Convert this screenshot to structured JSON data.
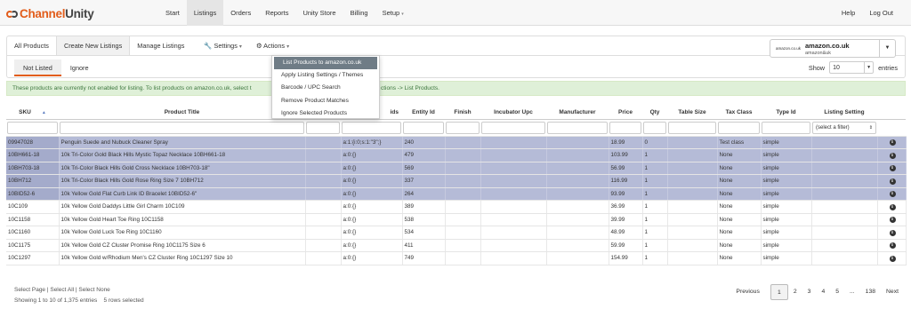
{
  "brand": {
    "part1": "Channel",
    "part2": "Unity"
  },
  "nav": {
    "items": [
      "Start",
      "Listings",
      "Orders",
      "Reports",
      "Unity Store",
      "Billing",
      "Setup"
    ],
    "right": [
      "Help",
      "Log Out"
    ]
  },
  "tabs": {
    "all": "All Products",
    "create": "Create New Listings",
    "manage": "Manage Listings",
    "settings": "Settings",
    "actions": "Actions"
  },
  "subtabs": {
    "not_listed": "Not Listed",
    "ignore": "Ignore"
  },
  "account": {
    "logo_text": "amazon.co.uk",
    "name": "amazon.co.uk",
    "sub": "amazon&uk"
  },
  "show": {
    "label": "Show",
    "value": "10",
    "suffix": "entries"
  },
  "notice": {
    "left": "These products are currently not enabled for listing. To list products on amazon.co.uk, select t",
    "right": "ctions -> List Products."
  },
  "dropdown": [
    "List Products to amazon.co.uk",
    "Apply Listing Settings / Themes",
    "Barcode / UPC Search",
    "Remove Product Matches",
    "Ignore Selected Products"
  ],
  "columns": [
    "SKU",
    "Product Title",
    "ids",
    "Entity Id",
    "Finish",
    "Incubator Upc",
    "Manufacturer",
    "Price",
    "Qty",
    "Table Size",
    "Tax Class",
    "Type Id",
    "Listing Setting"
  ],
  "filter_select": "(select a filter)",
  "rows": [
    {
      "sku": "09947028",
      "title": "Penguin Suede and Nubuck Cleaner Spray",
      "ids": "a:1:{i:0;s:1:\"3\";}",
      "entity": "240",
      "price": "18.99",
      "qty": "0",
      "tax": "Test class",
      "type": "simple",
      "selected": true
    },
    {
      "sku": "10BH661-18",
      "title": "10k Tri-Color Gold Black Hills Mystic Topaz Necklace 10BH661-18",
      "ids": "a:0:{}",
      "entity": "479",
      "price": "103.99",
      "qty": "1",
      "tax": "None",
      "type": "simple",
      "selected": true
    },
    {
      "sku": "10BH703-18",
      "title": "10k Tri-Color Black Hills Gold Cross Necklace 10BH703-18\"",
      "ids": "a:0:{}",
      "entity": "569",
      "price": "56.99",
      "qty": "1",
      "tax": "None",
      "type": "simple",
      "selected": true
    },
    {
      "sku": "10BH712",
      "title": "10k Tri-Color Black Hills Gold Rose Ring Size 7 10BH712",
      "ids": "a:0:{}",
      "entity": "337",
      "price": "116.99",
      "qty": "1",
      "tax": "None",
      "type": "simple",
      "selected": true
    },
    {
      "sku": "10BID52-6",
      "title": "10k Yellow Gold Flat Curb Link ID Bracelet 10BID52-6\"",
      "ids": "a:0:{}",
      "entity": "264",
      "price": "93.99",
      "qty": "1",
      "tax": "None",
      "type": "simple",
      "selected": true
    },
    {
      "sku": "10C109",
      "title": "10k Yellow Gold Daddys Little Girl Charm 10C109",
      "ids": "a:0:{}",
      "entity": "389",
      "price": "36.99",
      "qty": "1",
      "tax": "None",
      "type": "simple",
      "selected": false
    },
    {
      "sku": "10C1158",
      "title": "10k Yellow Gold Heart Toe Ring 10C1158",
      "ids": "a:0:{}",
      "entity": "538",
      "price": "39.99",
      "qty": "1",
      "tax": "None",
      "type": "simple",
      "selected": false
    },
    {
      "sku": "10C1160",
      "title": "10k Yellow Gold Luck Toe Ring 10C1160",
      "ids": "a:0:{}",
      "entity": "534",
      "price": "48.99",
      "qty": "1",
      "tax": "None",
      "type": "simple",
      "selected": false
    },
    {
      "sku": "10C1175",
      "title": "10k Yellow Gold CZ Cluster Promise Ring 10C1175 Size 6",
      "ids": "a:0:{}",
      "entity": "411",
      "price": "59.99",
      "qty": "1",
      "tax": "None",
      "type": "simple",
      "selected": false
    },
    {
      "sku": "10C1297",
      "title": "10k Yellow Gold w/Rhodium Men's CZ Cluster Ring 10C1297 Size 10",
      "ids": "a:0:{}",
      "entity": "749",
      "price": "154.99",
      "qty": "1",
      "tax": "None",
      "type": "simple",
      "selected": false
    }
  ],
  "footer": {
    "select": "Select Page | Select All | Select None",
    "status": "Showing 1 to 10 of 1,375 entries    5 rows selected"
  },
  "pager": [
    "Previous",
    "1",
    "2",
    "3",
    "4",
    "5",
    "...",
    "138",
    "Next"
  ],
  "colors": {
    "accent": "#e25d1b",
    "selected_row": "#b5bbd7",
    "notice_bg": "#dff0d8"
  }
}
